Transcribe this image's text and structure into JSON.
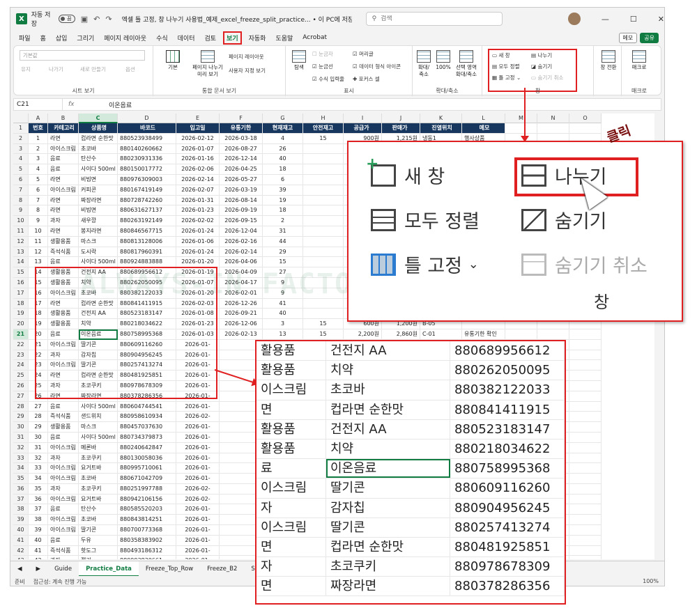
{
  "titlebar": {
    "autosave": "자동 저장",
    "toggle": "끔",
    "title": "엑셀 틀 고정, 창 나누기 사용법_예제_excel_freeze_split_practice... • 이 PC에 저장됨 ⌄",
    "search_placeholder": "검색"
  },
  "menu": [
    "파일",
    "홈",
    "삽입",
    "그리기",
    "페이지 레이아웃",
    "수식",
    "데이터",
    "검토",
    "보기",
    "자동화",
    "도움말",
    "Acrobat"
  ],
  "menu_selected": "보기",
  "menu_right": {
    "memo": "메모",
    "share": "공유"
  },
  "ribbon": {
    "sheetview": {
      "dropdown": "기본값",
      "keep": "유지",
      "exit": "나가기",
      "new": "새로 만들기",
      "options": "옵션",
      "label": "시트 보기"
    },
    "workbook": {
      "normal": "기본",
      "pagebreak": "페이지 나누기\n미리 보기",
      "pagelayout": "페이지 레이아웃",
      "custom": "사용자 지정 보기",
      "label": "통합 문서 보기"
    },
    "show": {
      "nav": "탐색",
      "ruler": "눈금자",
      "gridlines": "눈금선",
      "formulabar": "수식 입력줄",
      "headings": "머리글",
      "datafmt": "데이터 형식 아이콘",
      "focus": "포커스 셀",
      "label": "표시"
    },
    "zoom": {
      "zoom": "확대/\n축소",
      "z100": "100%",
      "zsel": "선택 영역\n확대/축소",
      "label": "확대/축소"
    },
    "window": {
      "newwin": "새 창",
      "arrange": "모두 정렬",
      "freeze": "틀 고정",
      "split": "나누기",
      "hide": "숨기기",
      "unhide": "숨기기 취소",
      "label": "창"
    },
    "switch": {
      "label": "창 전환"
    },
    "macro": {
      "macro": "매크로",
      "label": "매크로"
    }
  },
  "formula": {
    "namebox": "C21",
    "fx": "fx",
    "value": "이온음료"
  },
  "columns": [
    "A",
    "B",
    "C",
    "D",
    "E",
    "F",
    "G",
    "H",
    "I",
    "J",
    "K",
    "L",
    "M",
    "N",
    "O"
  ],
  "active_col": "C",
  "headers": [
    "번호",
    "카테고리",
    "상품명",
    "바코드",
    "입고일",
    "유통기한",
    "현재재고",
    "안전재고",
    "공급가",
    "판매가",
    "진열위치",
    "메모"
  ],
  "rows": [
    [
      "1",
      "라면",
      "컵라면 순한맛",
      "880523938499",
      "2026-02-12",
      "2026-03-18",
      "4",
      "15",
      "900원",
      "1,215원",
      "냉동1",
      "행사상품"
    ],
    [
      "2",
      "아이스크림",
      "초코바",
      "880140260662",
      "2026-01-07",
      "2026-08-27",
      "26",
      "",
      "",
      "",
      "",
      ""
    ],
    [
      "3",
      "음료",
      "탄산수",
      "880230931336",
      "2026-01-16",
      "2026-12-14",
      "40",
      "",
      "",
      "",
      "",
      ""
    ],
    [
      "4",
      "음료",
      "사이다 500ml",
      "880150017772",
      "2026-02-06",
      "2026-04-25",
      "18",
      "",
      "",
      "",
      "",
      ""
    ],
    [
      "5",
      "라면",
      "비빔면",
      "880976309003",
      "2026-02-14",
      "2026-05-27",
      "6",
      "",
      "",
      "",
      "",
      ""
    ],
    [
      "6",
      "아이스크림",
      "커피콘",
      "880167419149",
      "2026-02-07",
      "2026-03-19",
      "39",
      "",
      "",
      "",
      "",
      ""
    ],
    [
      "7",
      "라면",
      "짜장라면",
      "880728742260",
      "2026-01-31",
      "2026-08-14",
      "19",
      "",
      "",
      "",
      "",
      ""
    ],
    [
      "8",
      "라면",
      "비빔면",
      "880631627137",
      "2026-01-23",
      "2026-09-19",
      "18",
      "",
      "",
      "",
      "",
      ""
    ],
    [
      "9",
      "과자",
      "새우깡",
      "880263192149",
      "2026-02-02",
      "2026-09-15",
      "2",
      "",
      "",
      "",
      "",
      ""
    ],
    [
      "10",
      "라면",
      "봉지라면",
      "880846567715",
      "2026-01-24",
      "2026-12-04",
      "31",
      "",
      "",
      "",
      "",
      ""
    ],
    [
      "11",
      "생활용품",
      "마스크",
      "880813128006",
      "2026-01-06",
      "2026-02-16",
      "44",
      "",
      "",
      "",
      "",
      ""
    ],
    [
      "12",
      "즉석식품",
      "도시락",
      "880817960391",
      "2026-01-24",
      "2026-02-14",
      "29",
      "",
      "",
      "",
      "",
      ""
    ],
    [
      "13",
      "음료",
      "사이다 500ml",
      "880924883888",
      "2026-01-20",
      "2026-04-06",
      "15",
      "",
      "",
      "",
      "",
      ""
    ],
    [
      "14",
      "생활용품",
      "건전지 AA",
      "880689956612",
      "2026-01-19",
      "2026-04-09",
      "27",
      "",
      "",
      "",
      "",
      ""
    ],
    [
      "15",
      "생활용품",
      "치약",
      "880262050095",
      "2026-01-07",
      "2026-04-17",
      "9",
      "",
      "",
      "",
      "",
      ""
    ],
    [
      "16",
      "아이스크림",
      "초코바",
      "880382122033",
      "2026-01-20",
      "2026-02-01",
      "9",
      "",
      "",
      "",
      "",
      ""
    ],
    [
      "17",
      "라면",
      "컵라면 순한맛",
      "880841411915",
      "2026-02-03",
      "2026-12-26",
      "41",
      "",
      "",
      "",
      "",
      ""
    ],
    [
      "18",
      "생활용품",
      "건전지 AA",
      "880523183147",
      "2026-01-08",
      "2026-09-21",
      "40",
      "",
      "",
      "",
      "",
      ""
    ],
    [
      "19",
      "생활용품",
      "치약",
      "880218034622",
      "2026-01-23",
      "2026-12-06",
      "3",
      "15",
      "600원",
      "1,200원",
      "B-05",
      ""
    ],
    [
      "20",
      "음료",
      "이온음료",
      "880758995368",
      "2026-01-03",
      "2026-02-13",
      "13",
      "15",
      "2,200원",
      "2,860원",
      "C-01",
      "유통기한 확인"
    ],
    [
      "21",
      "아이스크림",
      "딸기콘",
      "880609116260",
      "2026-01-",
      "",
      "",
      "",
      "",
      "",
      "",
      ""
    ],
    [
      "22",
      "과자",
      "감자칩",
      "880904956245",
      "2026-01-",
      "",
      "",
      "",
      "",
      "",
      "",
      ""
    ],
    [
      "23",
      "아이스크림",
      "딸기콘",
      "880257413274",
      "2026-01-",
      "",
      "",
      "",
      "",
      "",
      "",
      ""
    ],
    [
      "24",
      "라면",
      "컵라면 순한맛",
      "880481925851",
      "2026-01-",
      "",
      "",
      "",
      "",
      "",
      "",
      ""
    ],
    [
      "25",
      "과자",
      "초코쿠키",
      "880978678309",
      "2026-01-",
      "",
      "",
      "",
      "",
      "",
      "",
      ""
    ],
    [
      "26",
      "라면",
      "짜장라면",
      "880378286356",
      "2026-01-",
      "",
      "",
      "",
      "",
      "",
      "",
      ""
    ],
    [
      "27",
      "음료",
      "사이다 500ml",
      "880604744541",
      "2026-01-",
      "",
      "",
      "",
      "",
      "",
      "",
      ""
    ],
    [
      "28",
      "즉석식품",
      "샌드위치",
      "880958610934",
      "2026-02-",
      "",
      "",
      "",
      "",
      "",
      "",
      ""
    ],
    [
      "29",
      "생활용품",
      "마스크",
      "880457037630",
      "2026-01-",
      "",
      "",
      "",
      "",
      "",
      "",
      ""
    ],
    [
      "30",
      "음료",
      "사이다 500ml",
      "880734379873",
      "2026-01-",
      "",
      "",
      "",
      "",
      "",
      "",
      ""
    ],
    [
      "31",
      "아이스크림",
      "메론바",
      "880240642847",
      "2026-01-",
      "",
      "",
      "",
      "",
      "",
      "",
      ""
    ],
    [
      "32",
      "과자",
      "초코쿠키",
      "880130058036",
      "2026-01-",
      "",
      "",
      "",
      "",
      "",
      "",
      ""
    ],
    [
      "33",
      "아이스크림",
      "요거트바",
      "880995710061",
      "2026-01-",
      "",
      "",
      "",
      "",
      "",
      "",
      ""
    ],
    [
      "34",
      "아이스크림",
      "초코바",
      "880671042709",
      "2026-01-",
      "",
      "",
      "",
      "",
      "",
      "",
      ""
    ],
    [
      "35",
      "과자",
      "초코쿠키",
      "880251997788",
      "2026-02-",
      "",
      "",
      "",
      "",
      "",
      "",
      ""
    ],
    [
      "36",
      "아이스크림",
      "요거트바",
      "880942106156",
      "2026-02-",
      "",
      "",
      "",
      "",
      "",
      "",
      ""
    ],
    [
      "37",
      "음료",
      "탄산수",
      "880585520203",
      "2026-01-",
      "",
      "",
      "",
      "",
      "",
      "",
      ""
    ],
    [
      "38",
      "아이스크림",
      "초코바",
      "880843814251",
      "2026-01-",
      "",
      "",
      "",
      "",
      "",
      "",
      ""
    ],
    [
      "39",
      "아이스크림",
      "딸기콘",
      "880700773368",
      "2026-01-",
      "",
      "",
      "",
      "",
      "",
      "",
      ""
    ],
    [
      "40",
      "음료",
      "두유",
      "880358383902",
      "2026-01-",
      "",
      "",
      "",
      "",
      "",
      "",
      ""
    ],
    [
      "41",
      "즉석식품",
      "핫도그",
      "880493186312",
      "2026-01-",
      "",
      "",
      "",
      "",
      "",
      "",
      ""
    ],
    [
      "42",
      "과자",
      "젤리",
      "880993830661",
      "2026-01-",
      "",
      "",
      "",
      "",
      "",
      "",
      ""
    ]
  ],
  "active_row": "21",
  "tabs": [
    "Guide",
    "Practice_Data",
    "Freeze_Top_Row",
    "Freeze_B2",
    "Sp"
  ],
  "active_tab": "Practice_Data",
  "status": {
    "ready": "준비",
    "access": "접근성: 계속 진행 가능",
    "zoom": "100%"
  },
  "watermark": "ALWAYS-IN FACTORY : EXCEL",
  "zoomA": {
    "newwin": "새 창",
    "split": "나누기",
    "arrange": "모두 정렬",
    "hide": "숨기기",
    "freeze": "틀 고정",
    "unhide": "숨기기 취소",
    "label": "창",
    "click": "클릭"
  },
  "zoomB": [
    [
      "활용품",
      "건전지 AA",
      "880689956612"
    ],
    [
      "활용품",
      "치약",
      "880262050095"
    ],
    [
      "이스크림",
      "초코바",
      "880382122033"
    ],
    [
      "면",
      "컵라면 순한맛",
      "880841411915"
    ],
    [
      "활용품",
      "건전지 AA",
      "880523183147"
    ],
    [
      "활용품",
      "치약",
      "880218034622"
    ],
    [
      "료",
      "이온음료",
      "880758995368"
    ],
    [
      "이스크림",
      "딸기콘",
      "880609116260"
    ],
    [
      "자",
      "감자칩",
      "880904956245"
    ],
    [
      "이스크림",
      "딸기콘",
      "880257413274"
    ],
    [
      "면",
      "컵라면 순한맛",
      "880481925851"
    ],
    [
      "자",
      "초코쿠키",
      "880978678309"
    ],
    [
      "면",
      "짜장라면",
      "880378286356"
    ]
  ],
  "zoomB_active": 6
}
